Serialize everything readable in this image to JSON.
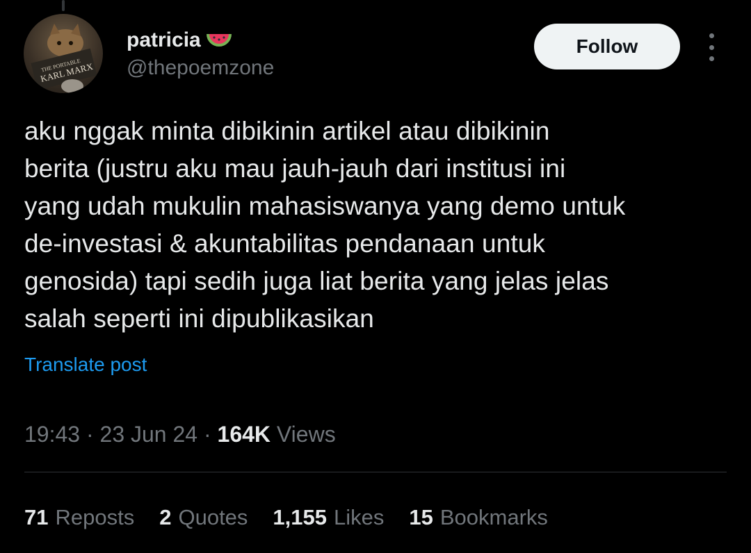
{
  "user": {
    "display_name": "patricia",
    "handle": "@thepoemzone",
    "name_emoji": "watermelon-icon",
    "avatar_text_top": "THE PORTABLE",
    "avatar_text_bottom": "KARL MARX"
  },
  "follow_label": "Follow",
  "more_icon": "more-options-icon",
  "tweet": {
    "text": "aku nggak minta dibikinin artikel atau dibikinin\nberita (justru aku mau jauh-jauh dari institusi ini\nyang udah mukulin mahasiswanya yang demo untuk\nde-investasi & akuntabilitas pendanaan untuk\ngenosida) tapi sedih juga liat berita yang jelas jelas\nsalah seperti ini dipublikasikan",
    "translate_label": "Translate post",
    "time": "19:43",
    "sep1": " · ",
    "date": "23 Jun 24",
    "sep2": " · ",
    "views_count": "164K",
    "views_label": "Views"
  },
  "stats": {
    "reposts_count": "71",
    "reposts_label": "Reposts",
    "quotes_count": "2",
    "quotes_label": "Quotes",
    "likes_count": "1,155",
    "likes_label": "Likes",
    "bookmarks_count": "15",
    "bookmarks_label": "Bookmarks"
  },
  "colors": {
    "background": "#000000",
    "text": "#e7e9ea",
    "secondary": "#71767b",
    "link": "#1d9bf0",
    "follow_bg": "#eff3f4"
  }
}
